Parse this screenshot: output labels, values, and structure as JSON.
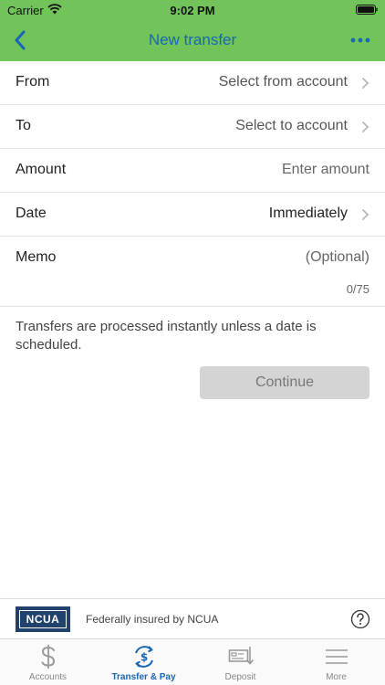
{
  "status_bar": {
    "carrier": "Carrier",
    "time": "9:02 PM"
  },
  "navbar": {
    "title": "New transfer",
    "back_icon": "chevron-left-icon",
    "more_icon": "ellipsis-icon"
  },
  "form": {
    "from": {
      "label": "From",
      "value": "Select from account"
    },
    "to": {
      "label": "To",
      "value": "Select to account"
    },
    "amount": {
      "label": "Amount",
      "placeholder": "Enter amount"
    },
    "date": {
      "label": "Date",
      "value": "Immediately"
    },
    "memo": {
      "label": "Memo",
      "placeholder": "(Optional)",
      "counter": "0/75"
    }
  },
  "notice": "Transfers are processed instantly unless a date is scheduled.",
  "continue_label": "Continue",
  "footer": {
    "logo_text": "NCUA",
    "insured_text": "Federally insured by NCUA"
  },
  "tabs": [
    {
      "label": "Accounts",
      "icon": "dollar-icon",
      "active": false
    },
    {
      "label": "Transfer & Pay",
      "icon": "transfer-icon",
      "active": true
    },
    {
      "label": "Deposit",
      "icon": "deposit-check-icon",
      "active": false
    },
    {
      "label": "More",
      "icon": "menu-icon",
      "active": false
    }
  ],
  "colors": {
    "header": "#72c35a",
    "accent": "#1966b5",
    "button_disabled": "#d4d4d4",
    "ncua_blue": "#20426b"
  }
}
